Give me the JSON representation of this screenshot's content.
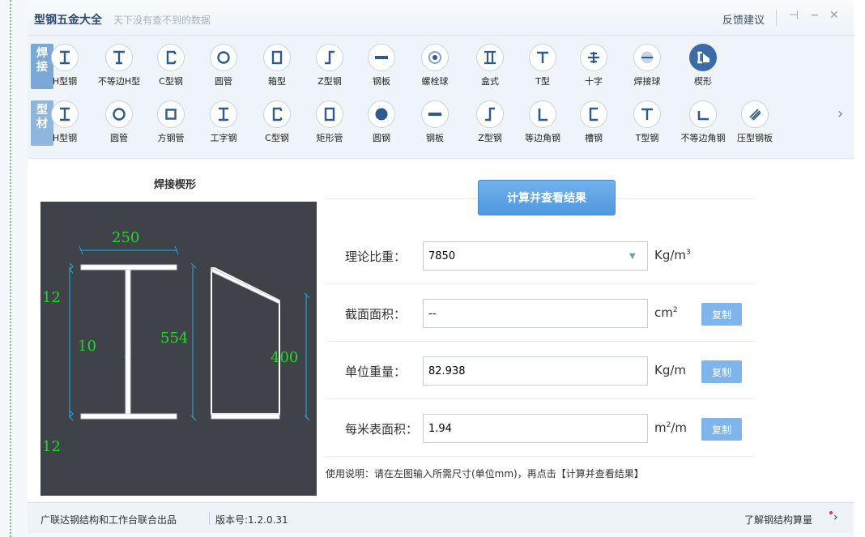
{
  "title_bar": {
    "app_title": "型钢五金大全",
    "slogan": "天下没有查不到的数据",
    "feedback": "反馈建议",
    "pin": "⊣",
    "minimize": "−",
    "close": "✕"
  },
  "toolbar": {
    "row1_tab": "焊\n接",
    "row2_tab": "型\n材",
    "row1": [
      {
        "label": "H型钢",
        "icon": "i-beam-icon"
      },
      {
        "label": "不等边H型",
        "icon": "unequal-i-beam-icon"
      },
      {
        "label": "C型钢",
        "icon": "c-channel-icon"
      },
      {
        "label": "圆管",
        "icon": "round-tube-icon"
      },
      {
        "label": "箱型",
        "icon": "box-section-icon"
      },
      {
        "label": "Z型钢",
        "icon": "z-section-icon"
      },
      {
        "label": "钢板",
        "icon": "steel-plate-icon"
      },
      {
        "label": "螺栓球",
        "icon": "bolt-ball-icon"
      },
      {
        "label": "盒式",
        "icon": "box-type-icon"
      },
      {
        "label": "T型",
        "icon": "t-section-icon"
      },
      {
        "label": "十字",
        "icon": "cross-section-icon"
      },
      {
        "label": "焊接球",
        "icon": "welded-ball-icon"
      },
      {
        "label": "楔形",
        "icon": "wedge-section-icon"
      }
    ],
    "row2": [
      {
        "label": "H型钢",
        "icon": "i-beam-icon"
      },
      {
        "label": "圆管",
        "icon": "round-tube-icon"
      },
      {
        "label": "方钢管",
        "icon": "square-tube-icon"
      },
      {
        "label": "工字钢",
        "icon": "i-steel-icon"
      },
      {
        "label": "C型钢",
        "icon": "c-channel-icon"
      },
      {
        "label": "矩形管",
        "icon": "rect-tube-icon"
      },
      {
        "label": "圆钢",
        "icon": "round-bar-icon"
      },
      {
        "label": "钢板",
        "icon": "steel-plate-icon"
      },
      {
        "label": "Z型钢",
        "icon": "z-section-icon"
      },
      {
        "label": "等边角钢",
        "icon": "equal-angle-icon"
      },
      {
        "label": "槽钢",
        "icon": "channel-icon"
      },
      {
        "label": "T型钢",
        "icon": "t-section-icon"
      },
      {
        "label": "不等边角钢",
        "icon": "unequal-angle-icon"
      },
      {
        "label": "压型钢板",
        "icon": "profiled-sheet-icon"
      }
    ],
    "next": "›"
  },
  "main": {
    "figure_title": "焊接楔形",
    "dims": {
      "top_flange_width": "250",
      "top_flange_thk": "12",
      "web_thk": "10",
      "height_left": "554",
      "height_right": "400",
      "bottom_flange_thk": "12"
    },
    "calc_button": "计算并查看结果",
    "fields": [
      {
        "label": "理论比重：",
        "value": "7850",
        "unit": "Kg/m",
        "unit_sup": "3",
        "has_dropdown": true
      },
      {
        "label": "截面面积：",
        "value": "--",
        "unit": "cm",
        "unit_sup": "2",
        "copy": "复制"
      },
      {
        "label": "单位重量：",
        "value": "82.938",
        "unit": "Kg/m",
        "copy": "复制"
      },
      {
        "label": "每米表面积：",
        "value": "1.94",
        "unit": "m",
        "unit_sup": "2",
        "unit_tail": "/m",
        "copy": "复制"
      }
    ],
    "usage": "使用说明：请在左图输入所需尺寸(单位mm)，再点击【计算并查看结果】"
  },
  "status_bar": {
    "producer": "广联达钢结构和工作台联合出品",
    "version": "版本号:1.2.0.31",
    "learn": "了解钢结构算量"
  },
  "colors": {
    "accent": "#4d98df",
    "dim_text": "#22d62a",
    "dim_line": "#19b4e6",
    "diagram_bg": "#3f4349",
    "copy_button": "#7fb5ea"
  }
}
